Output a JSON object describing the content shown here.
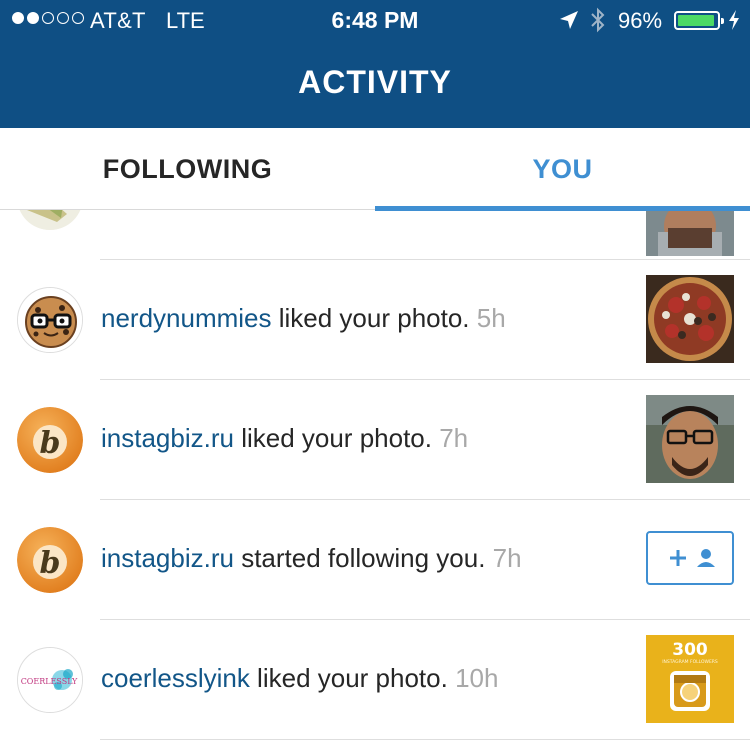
{
  "status_bar": {
    "carrier": "AT&T",
    "network": "LTE",
    "time": "6:48 PM",
    "battery_pct": "96%",
    "battery_level": 0.96,
    "signal_bars_filled": 2,
    "signal_bars_total": 5
  },
  "header": {
    "title": "ACTIVITY"
  },
  "tabs": [
    {
      "label": "FOLLOWING",
      "active": false
    },
    {
      "label": "YOU",
      "active": true
    }
  ],
  "notifications": [
    {
      "username": "nerdynummies",
      "action": " liked your photo.",
      "time": "5h",
      "avatar_icon": "cookie-glasses-avatar",
      "thumb_icon": "pizza-photo"
    },
    {
      "username": "instagbiz.ru",
      "action": " liked your photo.",
      "time": "7h",
      "avatar_icon": "orange-b-logo-avatar",
      "thumb_icon": "selfie-photo"
    },
    {
      "username": "instagbiz.ru",
      "action": " started following you.",
      "time": "7h",
      "avatar_icon": "orange-b-logo-avatar",
      "follow_button_icon": "add-user-icon"
    },
    {
      "username": "coerlesslyink",
      "action": " liked your photo.",
      "time": "10h",
      "avatar_icon": "coerlessly-logo-avatar",
      "thumb_icon": "followers-300-photo"
    }
  ],
  "thumb_300": {
    "number": "300",
    "caption": "INSTAGRAM FOLLOWERS"
  },
  "coerlessly_logo_text": "COERLESSLY",
  "colors": {
    "header_bg": "#0f4f84",
    "accent": "#3f8fd2",
    "username": "#125688",
    "timestamp": "#a8a8a8",
    "battery_fill": "#4cd964"
  }
}
